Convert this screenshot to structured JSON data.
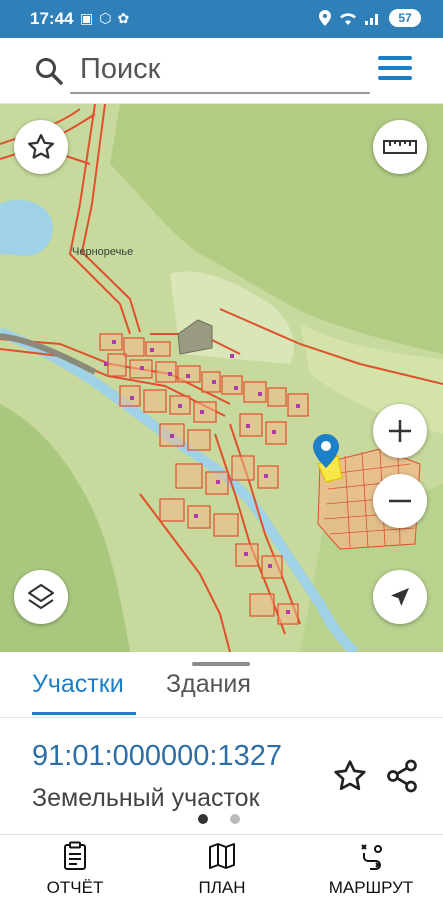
{
  "status_bar": {
    "time": "17:44",
    "battery": "57"
  },
  "search": {
    "placeholder": "Поиск"
  },
  "map": {
    "place_label": "Черноречье",
    "icons": {
      "favorites": "star-icon",
      "ruler": "ruler-icon",
      "zoom_in": "plus-icon",
      "zoom_out": "minus-icon",
      "layers": "layers-icon",
      "locate": "navigation-arrow-icon",
      "marker": "location-pin-icon"
    },
    "colors": {
      "terrain": "#c7d99c",
      "water": "#9fd2e6",
      "parcel_border": "#e0502c",
      "parcel_fill": "#f0b888",
      "accent": "#1d7fc6"
    }
  },
  "tabs": {
    "items": [
      {
        "label": "Участки",
        "active": true
      },
      {
        "label": "Здания",
        "active": false
      }
    ]
  },
  "parcel": {
    "cadastral_number": "91:01:000000:1327",
    "type": "Земельный участок"
  },
  "bottom_nav": {
    "items": [
      {
        "label": "ОТЧЁТ",
        "icon": "report-icon"
      },
      {
        "label": "ПЛАН",
        "icon": "map-plan-icon"
      },
      {
        "label": "МАРШРУТ",
        "icon": "route-icon"
      }
    ]
  }
}
